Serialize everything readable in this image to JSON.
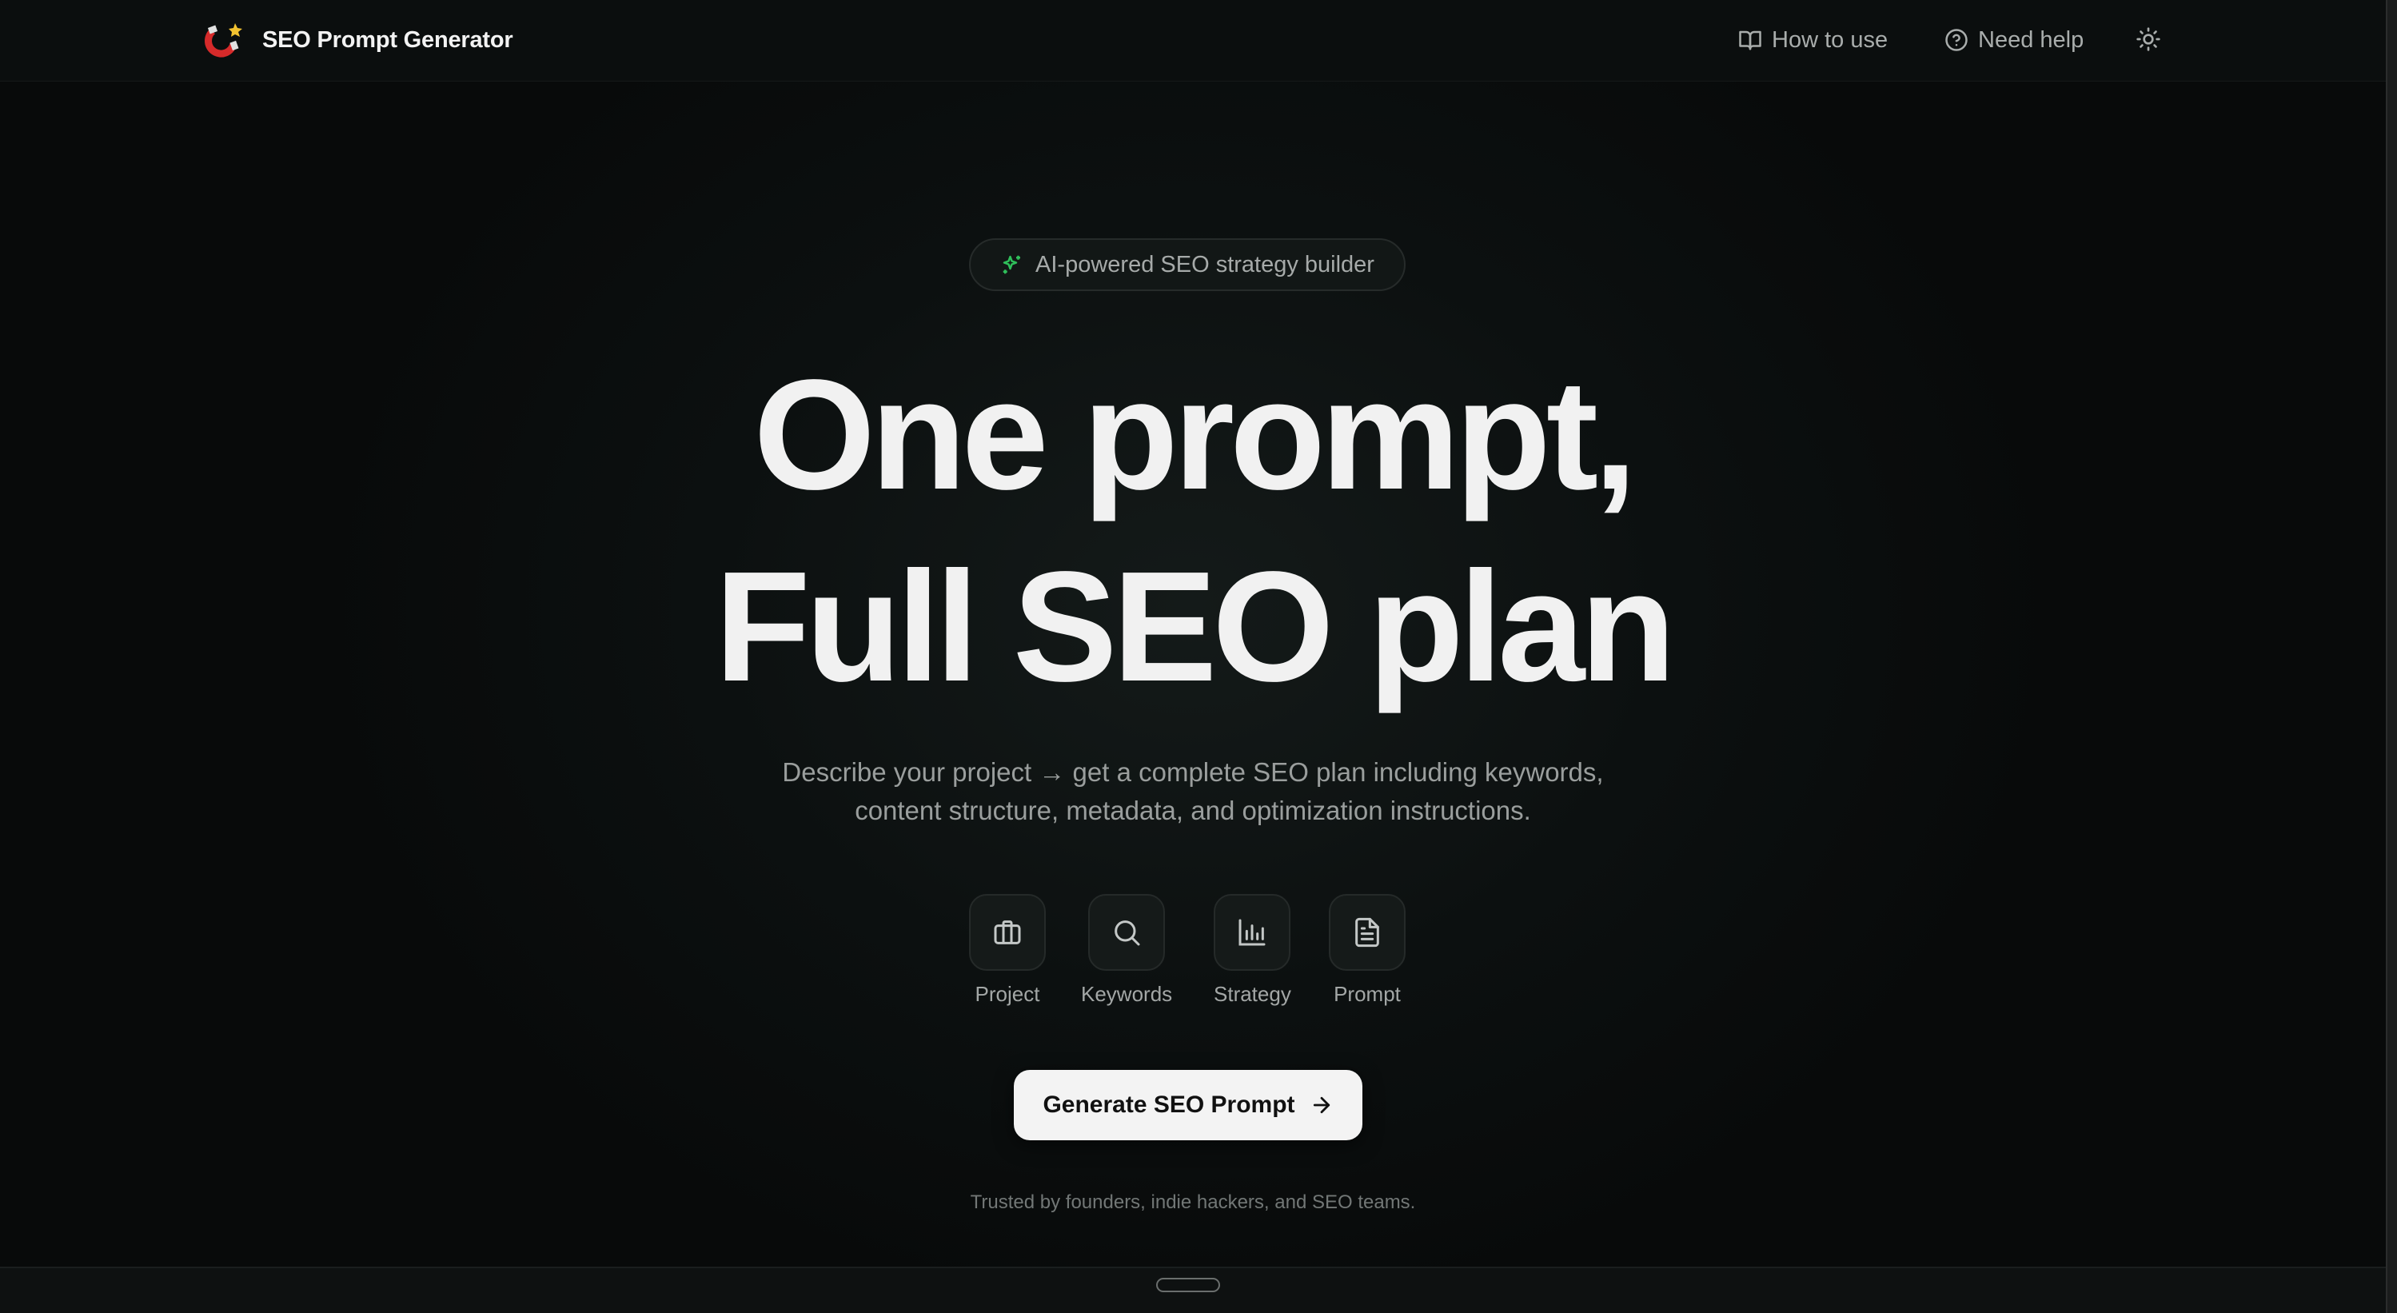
{
  "header": {
    "brand_name": "SEO Prompt Generator",
    "nav": [
      {
        "label": "How to use",
        "icon": "book-open-icon"
      },
      {
        "label": "Need help",
        "icon": "help-circle-icon"
      }
    ],
    "theme_toggle_icon": "sun-icon"
  },
  "hero": {
    "badge": "AI-powered SEO strategy builder",
    "title_line1": "One prompt,",
    "title_line2": "Full SEO plan",
    "subtitle_line1": "Describe your project → get a complete SEO plan including keywords,",
    "subtitle_line2": "content structure, metadata, and optimization instructions."
  },
  "steps": [
    {
      "label": "Project",
      "icon": "briefcase-icon"
    },
    {
      "label": "Keywords",
      "icon": "search-icon"
    },
    {
      "label": "Strategy",
      "icon": "bar-chart-icon"
    },
    {
      "label": "Prompt",
      "icon": "file-text-icon"
    }
  ],
  "cta": {
    "label": "Generate SEO Prompt",
    "icon": "arrow-right-icon"
  },
  "trusted": "Trusted by founders, indie hackers, and SEO teams.",
  "colors": {
    "background": "#0a0d0d",
    "accent_green": "#2fbf5a",
    "brand_red": "#d62a2a",
    "cta_bg": "#f3f3f3"
  }
}
